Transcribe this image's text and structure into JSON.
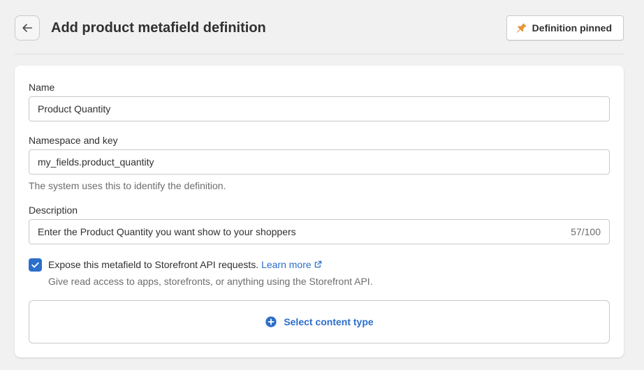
{
  "header": {
    "title": "Add product metafield definition",
    "pin_label": "Definition pinned"
  },
  "form": {
    "name": {
      "label": "Name",
      "value": "Product Quantity"
    },
    "namespace": {
      "label": "Namespace and key",
      "value": "my_fields.product_quantity",
      "help": "The system uses this to identify the definition."
    },
    "description": {
      "label": "Description",
      "value": "Enter the Product Quantity you want show to your shoppers",
      "counter": "57/100"
    },
    "storefront": {
      "label": "Expose this metafield to Storefront API requests.",
      "link": "Learn more",
      "help": "Give read access to apps, storefronts, or anything using the Storefront API.",
      "checked": true
    },
    "content_type": {
      "label": "Select content type"
    }
  },
  "colors": {
    "accent": "#2c6ecb",
    "pin": "#e8943a"
  }
}
